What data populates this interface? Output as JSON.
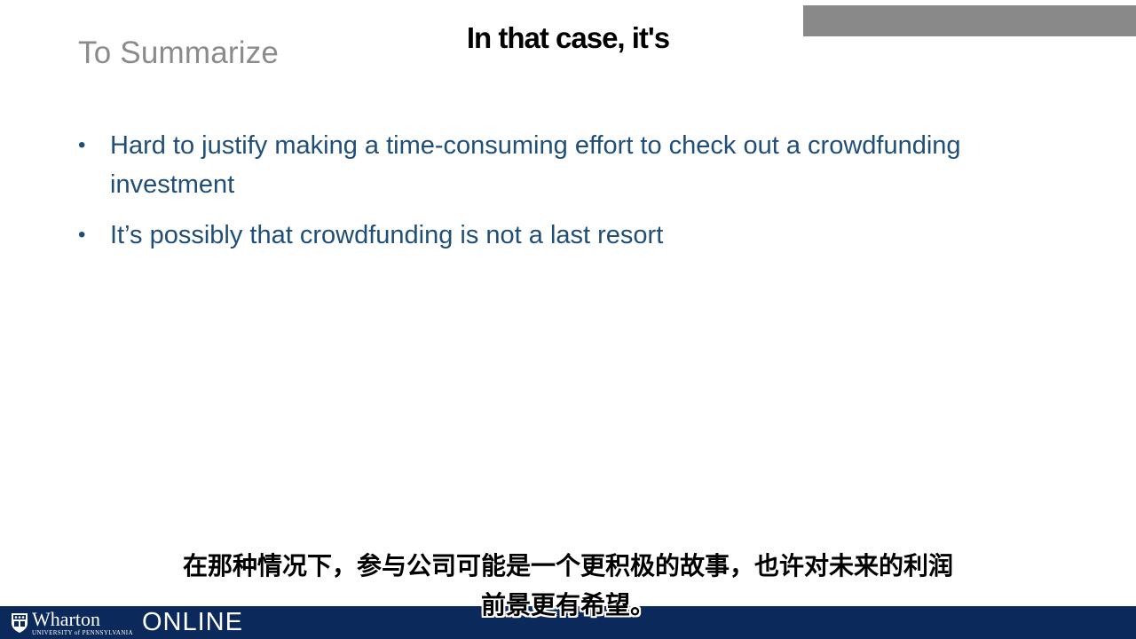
{
  "slide": {
    "title": "To Summarize",
    "bullets": [
      "Hard to justify making a time-consuming effort to check out a crowdfunding investment",
      "It’s possibly that crowdfunding is not a last resort"
    ],
    "bullet_glyph": "•"
  },
  "captions": {
    "english": "In that case, it's",
    "chinese_line1": "在那种情况下，参与公司可能是一个更积极的故事，也许对未来的利润",
    "chinese_line2": "前景更有希望。"
  },
  "footer": {
    "brand": "Wharton",
    "brand_sub": "UNIVERSITY of PENNSYLVANIA",
    "online_label": "ONLINE",
    "bar_color": "#0b2a5b"
  },
  "colors": {
    "title": "#8b8b8b",
    "bullet_text": "#1f4e79",
    "corner_block": "#898989"
  }
}
